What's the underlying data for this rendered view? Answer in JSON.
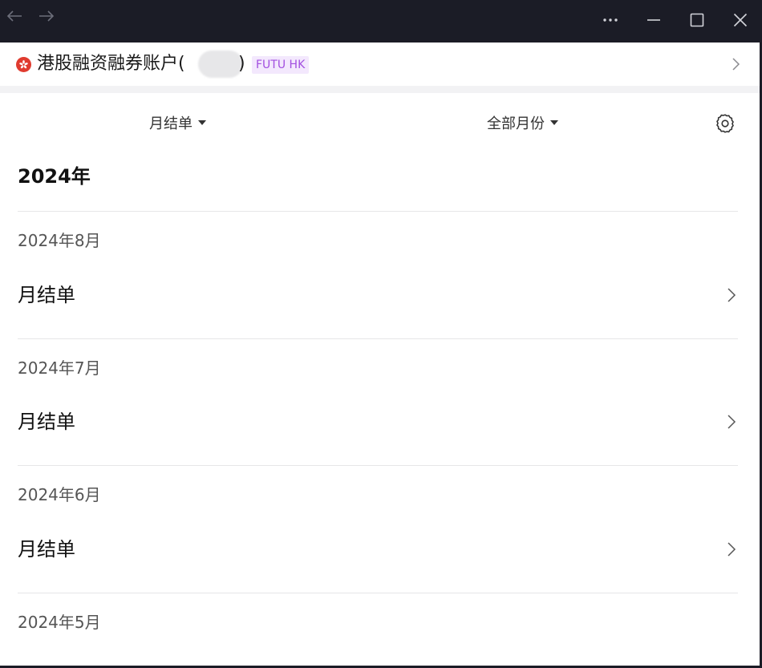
{
  "window": {
    "icons": {
      "back": "arrow-left-icon",
      "forward": "arrow-right-icon",
      "more": "more-horizontal-icon",
      "minimize": "minimize-icon",
      "maximize": "maximize-icon",
      "close": "close-icon"
    }
  },
  "account": {
    "name": "港股融资融券账户(",
    "name_suffix": ")",
    "broker_badge": "FUTU HK",
    "flag": "hong-kong-flag-icon",
    "masked": true
  },
  "filters": {
    "statement_type": "月结单",
    "month": "全部月份"
  },
  "year": "2024年",
  "months": [
    {
      "label": "2024年8月",
      "statement": "月结单"
    },
    {
      "label": "2024年7月",
      "statement": "月结单"
    },
    {
      "label": "2024年6月",
      "statement": "月结单"
    },
    {
      "label": "2024年5月",
      "statement": ""
    }
  ],
  "colors": {
    "titlebar_bg": "#1b1c26",
    "badge_text": "#a24fe0",
    "badge_bg": "#f3e8fd",
    "flag_red": "#e03b2f"
  }
}
